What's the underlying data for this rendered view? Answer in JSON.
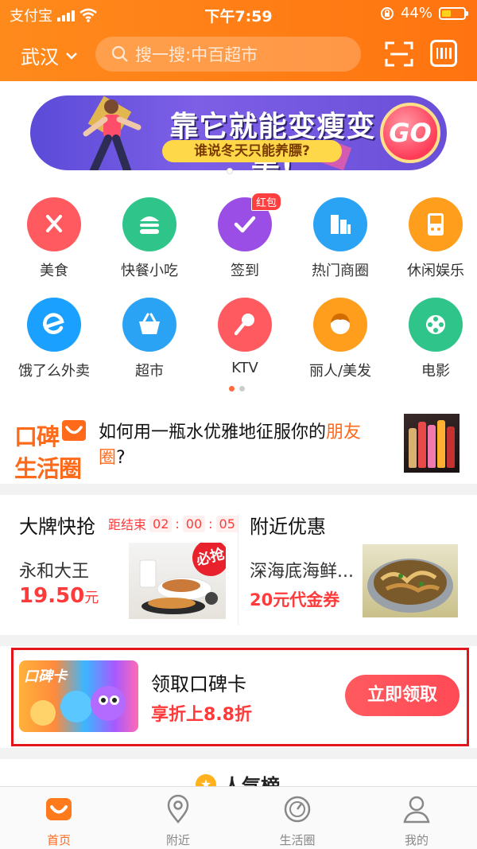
{
  "status": {
    "carrier": "支付宝",
    "time": "下午7:59",
    "battery": "44%",
    "battery_level": 0.44
  },
  "header": {
    "city": "武汉",
    "search_placeholder": "搜一搜:中百超市",
    "icons": [
      "chevron-down-icon",
      "search-icon",
      "scan-icon",
      "barcode-icon"
    ]
  },
  "banner": {
    "title": "靠它就能变瘦变美!",
    "subtitle": "谁说冬天只能养膘?",
    "cta": "GO"
  },
  "categories": [
    {
      "label": "美食",
      "icon": "fork-spoon-icon",
      "color": "#ff5a5f"
    },
    {
      "label": "快餐小吃",
      "icon": "burger-icon",
      "color": "#2ec48a"
    },
    {
      "label": "签到",
      "icon": "check-icon",
      "color": "#9b4ee6",
      "badge": "红包"
    },
    {
      "label": "热门商圈",
      "icon": "buildings-icon",
      "color": "#2aa3f5"
    },
    {
      "label": "休闲娱乐",
      "icon": "gameboy-icon",
      "color": "#ff9e1c"
    },
    {
      "label": "饿了么外卖",
      "icon": "eleme-icon",
      "color": "#1aa0ff"
    },
    {
      "label": "超市",
      "icon": "basket-icon",
      "color": "#2aa3f5"
    },
    {
      "label": "KTV",
      "icon": "microphone-icon",
      "color": "#ff5a5f"
    },
    {
      "label": "丽人/美发",
      "icon": "woman-icon",
      "color": "#ff9e1c"
    },
    {
      "label": "电影",
      "icon": "film-reel-icon",
      "color": "#2ec48a"
    }
  ],
  "pager": {
    "pages": 2,
    "active": 0
  },
  "koubei": {
    "logo_line1": "口碑",
    "logo_line2": "生活圈",
    "article_prefix": "如何用一瓶水优雅地征服你的",
    "article_highlight": "朋友圈",
    "article_suffix": "?"
  },
  "deals": {
    "flash": {
      "title": "大牌快抢",
      "countdown_label": "距结束",
      "countdown": [
        "02",
        "00",
        "05"
      ],
      "name": "永和大王",
      "price": "19.50",
      "price_unit": "元",
      "stamp": "必抢"
    },
    "nearby": {
      "title": "附近优惠",
      "name": "深海底海鲜...",
      "offer": "20元代金券"
    }
  },
  "card_promo": {
    "card_tag": "口碑卡",
    "title": "领取口碑卡",
    "subtitle": "享折上8.8折",
    "button": "立即领取"
  },
  "popular": {
    "title": "人气榜"
  },
  "tabbar": [
    {
      "label": "首页",
      "icon": "koubei-home-icon",
      "active": true
    },
    {
      "label": "附近",
      "icon": "location-pin-icon",
      "active": false
    },
    {
      "label": "生活圈",
      "icon": "life-circle-icon",
      "active": false
    },
    {
      "label": "我的",
      "icon": "user-icon",
      "active": false
    }
  ]
}
